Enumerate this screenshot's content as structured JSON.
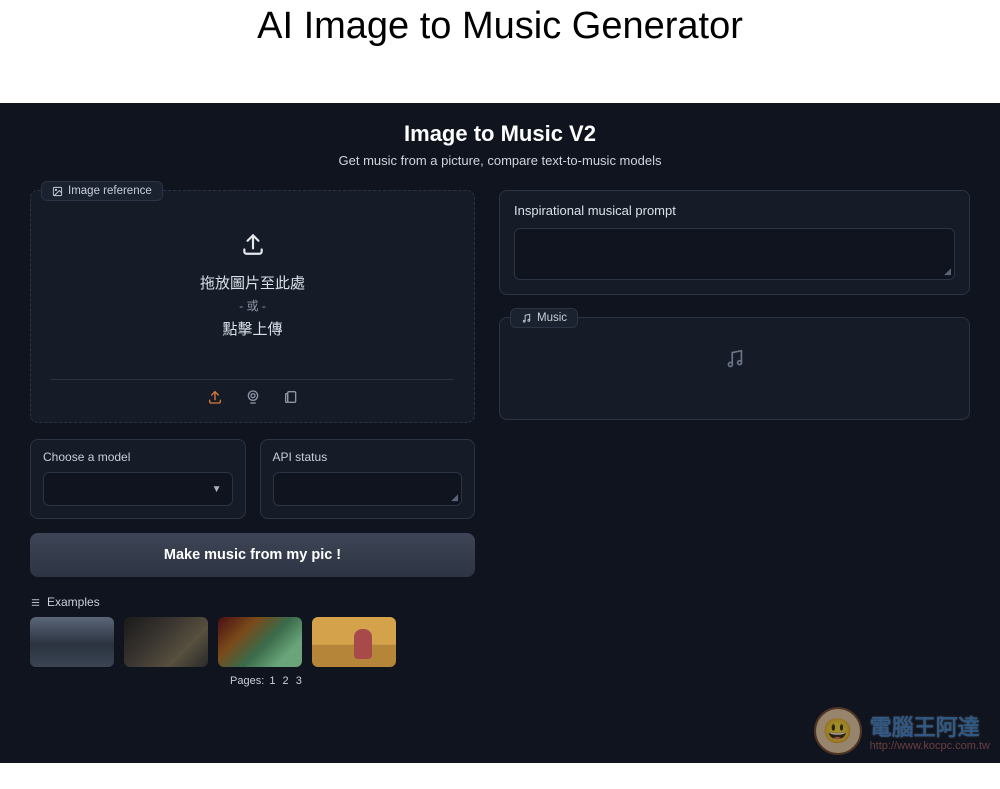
{
  "header": {
    "title": "AI Image to Music Generator"
  },
  "app": {
    "title": "Image to Music V2",
    "subtitle": "Get music from a picture, compare text-to-music models"
  },
  "upload": {
    "tab_label": "Image reference",
    "drop_text": "拖放圖片至此處",
    "or_text": "- 或 -",
    "click_text": "點擊上傳"
  },
  "model": {
    "label": "Choose a model",
    "selected": ""
  },
  "status": {
    "label": "API status",
    "value": ""
  },
  "action": {
    "button_label": "Make music from my pic !"
  },
  "examples": {
    "label": "Examples",
    "pager_prefix": "Pages:",
    "pages": [
      "1",
      "2",
      "3"
    ]
  },
  "prompt": {
    "label": "Inspirational musical prompt",
    "value": ""
  },
  "music": {
    "tab_label": "Music"
  },
  "watermark": {
    "text": "電腦王阿達",
    "url": "http://www.kocpc.com.tw"
  }
}
